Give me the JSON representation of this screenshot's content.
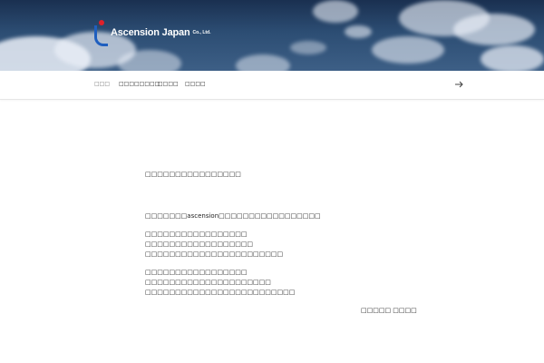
{
  "header": {
    "company_name": "Ascension Japan",
    "company_suffix": "Co., Ltd."
  },
  "nav": {
    "items": [
      {
        "label": "□□□",
        "active": true
      },
      {
        "label": "□□□□□□□□"
      },
      {
        "label": "□□□□"
      },
      {
        "label": "□□□□"
      }
    ],
    "arrow_icon": "arrow-right-icon"
  },
  "main": {
    "heading": "□□□□□□□□□□□□□□□□",
    "intro": "□□□□□□□ascension□□□□□□□□□□□□□□□□□",
    "paragraph1": [
      "□□□□□□□□□□□□□□□□□",
      "□□□□□□□□□□□□□□□□□□",
      "□□□□□□□□□□□□□□□□□□□□□□□"
    ],
    "paragraph2": [
      "□□□□□□□□□□□□□□□□□",
      "□□□□□□□□□□□□□□□□□□□□□",
      "□□□□□□□□□□□□□□□□□□□□□□□□□"
    ],
    "signature": "□□□□□ □□□□"
  }
}
